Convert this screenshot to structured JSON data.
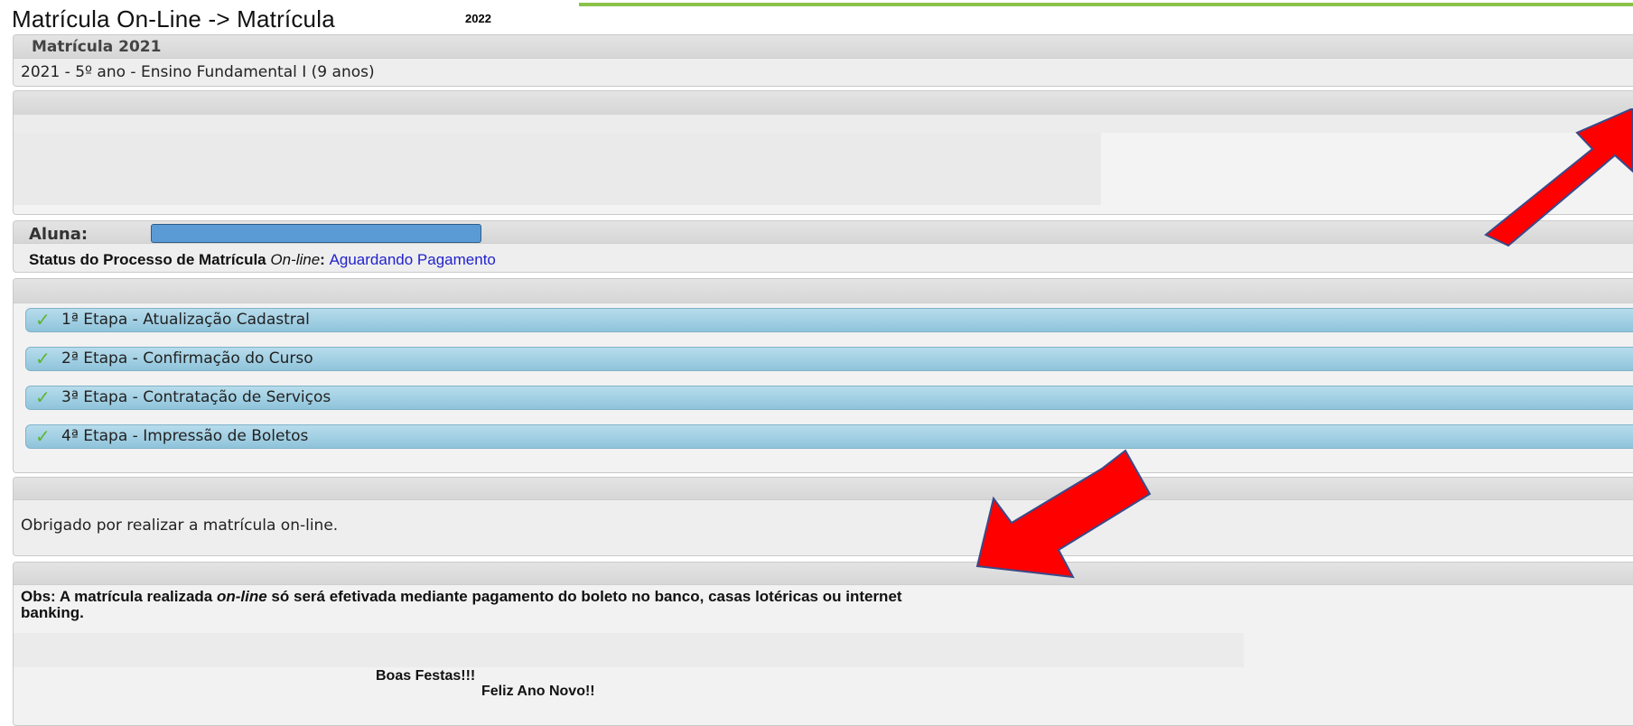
{
  "header": {
    "title": "Matrícula On-Line -> Matrícula",
    "year_tag": "2022"
  },
  "enrollment": {
    "section_title": "Matrícula 2021",
    "course": "2021 - 5º ano - Ensino Fundamental I (9 anos)"
  },
  "student": {
    "label": "Aluna:",
    "status_prefix": "Status do Processo de Matrícula ",
    "status_online": "On-line",
    "status_colon": ": ",
    "status_value": "Aguardando Pagamento"
  },
  "steps": [
    {
      "label": "1ª Etapa - Atualização Cadastral",
      "done": true
    },
    {
      "label": "2ª Etapa - Confirmação do Curso",
      "done": true
    },
    {
      "label": "3ª Etapa - Contratação de Serviços",
      "done": true
    },
    {
      "label": "4ª Etapa - Impressão de Boletos",
      "done": true
    }
  ],
  "thanks": "Obrigado por realizar a matrícula on-line.",
  "notice": {
    "obs_prefix": "Obs: A matrícula realizada ",
    "obs_online": "on-line",
    "obs_line1_rest": " só será efetivada mediante pagamento do boleto no banco, casas lotéricas ou internet",
    "obs_line2": "banking.",
    "greeting1": "Boas Festas!!!",
    "greeting2": "Feliz Ano Novo!!"
  },
  "colors": {
    "accent_green": "#8bc34a",
    "status_blue": "#2222cc",
    "step_bar": "#a6d2e4",
    "check_green": "#5cb531",
    "annotation_arrow": "#ff0000"
  },
  "icons": {
    "step_check": "check-icon"
  },
  "check_glyph": "✓"
}
